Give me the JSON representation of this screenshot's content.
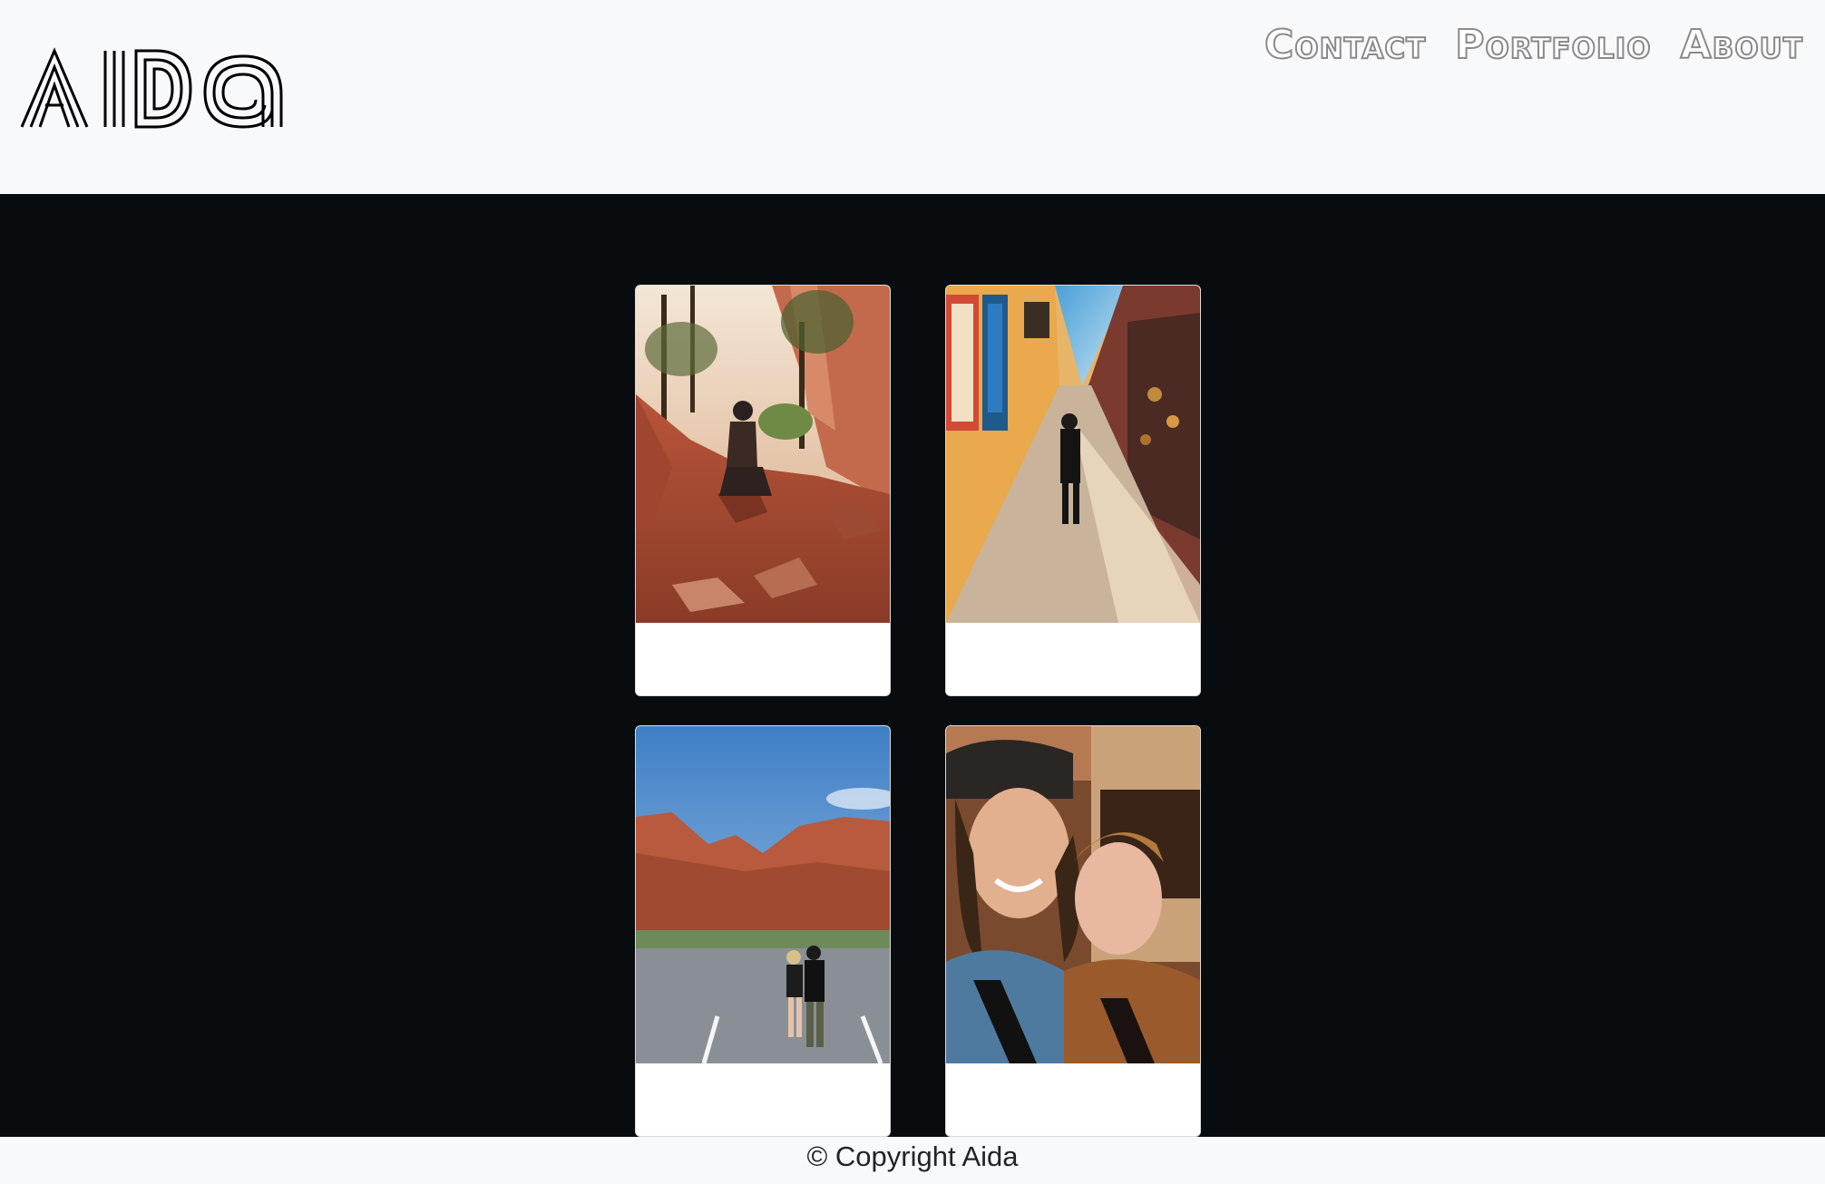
{
  "brand": {
    "name": "Aida"
  },
  "nav": {
    "links": [
      {
        "label": "Contact"
      },
      {
        "label": "Portfolio"
      },
      {
        "label": "About"
      }
    ]
  },
  "gallery": {
    "cards": [
      {
        "image": "canyon-rock-photo"
      },
      {
        "image": "market-alley-photo"
      },
      {
        "image": "red-rock-parking-lot-photo"
      },
      {
        "image": "couple-selfie-photo"
      }
    ]
  },
  "footer": {
    "text": "© Copyright Aida"
  },
  "colors": {
    "header_bg": "#f8f9fa",
    "main_bg": "#080c0e",
    "nav_stroke": "#8a8a8a",
    "card_bg": "#ffffff"
  }
}
